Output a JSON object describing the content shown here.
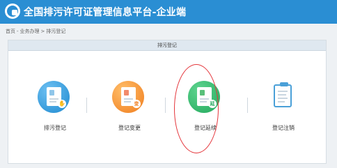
{
  "header": {
    "title": "全国排污许可证管理信息平台-企业端"
  },
  "breadcrumb": {
    "items": [
      "首页",
      "业务办理",
      "排污登记"
    ],
    "separators": [
      "-",
      ">"
    ]
  },
  "panel": {
    "title": "排污登记"
  },
  "cards": [
    {
      "label": "排污登记",
      "icon": "registration-icon",
      "color": "#1e8ad0"
    },
    {
      "label": "登记变更",
      "icon": "change-icon",
      "color": "#f07d1d",
      "badge": "变"
    },
    {
      "label": "登记延续",
      "icon": "renewal-icon",
      "color": "#22a85c",
      "badge": "延"
    },
    {
      "label": "登记注销",
      "icon": "cancellation-icon",
      "color": "#4aa0d8"
    }
  ],
  "annotation": {
    "color": "#e4343a"
  }
}
